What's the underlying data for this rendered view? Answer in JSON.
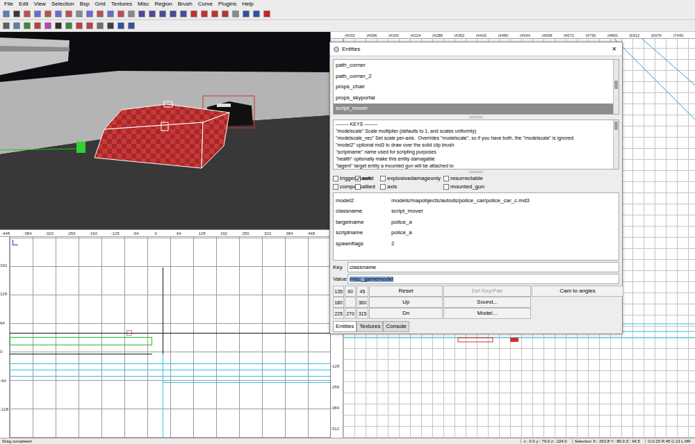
{
  "menu": [
    "File",
    "Edit",
    "View",
    "Selection",
    "Bsp",
    "Grid",
    "Textures",
    "Misc",
    "Region",
    "Brush",
    "Curve",
    "Plugins",
    "Help"
  ],
  "grid_bottom_left": {
    "ruler_x": [
      "-448",
      "-384",
      "-320",
      "-256",
      "-192",
      "-128",
      "-64",
      "0",
      "64",
      "128",
      "192",
      "256",
      "320",
      "384",
      "448"
    ],
    "ruler_y": [
      "192",
      "128",
      "64",
      "0",
      "-64",
      "-128"
    ]
  },
  "grid_right": {
    "ruler_x": [
      "4032",
      "4096",
      "4160",
      "4224",
      "4288",
      "4352",
      "4416",
      "4480",
      "4544",
      "4608",
      "4672",
      "4736",
      "4800",
      "6912",
      "6976",
      "7040"
    ],
    "ruler_y": [
      "-128",
      "-256",
      "-384",
      "-512"
    ]
  },
  "entities_dialog": {
    "title": "Entities",
    "close": "×",
    "classes": [
      {
        "name": "path_corner",
        "selected": false
      },
      {
        "name": "path_corner_2",
        "selected": false
      },
      {
        "name": "props_chair",
        "selected": false
      },
      {
        "name": "props_skyportal",
        "selected": false
      },
      {
        "name": "script_mover",
        "selected": true
      }
    ],
    "description": [
      "-------- KEYS --------",
      "\"modelscale\" Scale multiplier (defaults to 1, and scales uniformly)",
      "\"modelscale_vec\" Set scale per-axis.  Overrides \"modelscale\", so if you have both, the \"modelscale\" is ignored",
      "\"model2\" optional md3 to draw over the solid clip brush",
      "\"scriptname\" name used for scripting purposes",
      "\"health\" optionally make this entity damagable",
      "\"tagent\" target entity a mounted gun will be attached to"
    ],
    "flags": [
      {
        "label": "triggerspawn",
        "checked": false
      },
      {
        "label": "solid",
        "checked": true
      },
      {
        "label": "explosivedamageonly",
        "checked": false
      },
      {
        "label": "resurrectable",
        "checked": false
      },
      {
        "label": "compass",
        "checked": false
      },
      {
        "label": "allied",
        "checked": false
      },
      {
        "label": "axis",
        "checked": false
      },
      {
        "label": "mounted_gun",
        "checked": false
      }
    ],
    "pairs": [
      {
        "key": "model2",
        "value": "models/mapobjects/autods/police_car/police_car_c.md3"
      },
      {
        "key": "classname",
        "value": "script_mover"
      },
      {
        "key": "targetname",
        "value": "police_a"
      },
      {
        "key": "scriptname",
        "value": "police_a"
      },
      {
        "key": "spawnflags",
        "value": "2"
      }
    ],
    "key_field": {
      "label": "Key",
      "value": "classname"
    },
    "value_field": {
      "label": "Value",
      "value": "misc_gamemodel",
      "selected": true
    },
    "button_rows": [
      {
        "angles": [
          "135",
          "90",
          "45"
        ],
        "buttons": [
          {
            "label": "Reset",
            "disabled": false
          },
          {
            "label": "Del Key/Pair",
            "disabled": true
          },
          {
            "label": "Cam to angles",
            "disabled": false
          }
        ]
      },
      {
        "angles": [
          "180",
          "",
          "360"
        ],
        "buttons": [
          {
            "label": "Up",
            "disabled": false
          },
          {
            "label": "Sound...",
            "disabled": false
          }
        ]
      },
      {
        "angles": [
          "225",
          "270",
          "315"
        ],
        "buttons": [
          {
            "label": "Dn",
            "disabled": false
          },
          {
            "label": "Model...",
            "disabled": false
          }
        ]
      }
    ],
    "tabs": [
      {
        "label": "Entities",
        "selected": true
      },
      {
        "label": "Textures",
        "selected": false
      },
      {
        "label": "Console",
        "selected": false
      }
    ]
  },
  "status_bar": {
    "message": "Drag completed",
    "fields": [
      "x:: 0.0  y:: 79.0  z:: 224.0",
      "Selection X:: 253.8 Y:: 80.0 Z:: 94.5",
      "G:0.25 R:45 C:13 L:MF"
    ]
  }
}
